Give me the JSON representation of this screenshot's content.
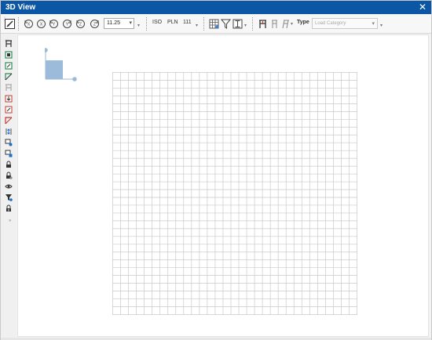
{
  "window": {
    "title": "3D View",
    "close_glyph": "✕"
  },
  "toolbar": {
    "zoom_value": "11.25",
    "view_iso": "ISO",
    "view_pln": "PLN",
    "view_num": "111",
    "type_label": "Type",
    "load_category_placeholder": "Load Category",
    "icons": [
      "pointer-icon",
      "rotate-left-x-icon",
      "rotate-x-icon",
      "rotate-left-y-icon",
      "rotate-y-icon",
      "rotate-left-z-icon",
      "rotate-z-icon",
      "grid-table-icon",
      "filter-icon",
      "display-options-icon",
      "member-load-icon",
      "member-outline-icon",
      "member-italic-icon"
    ]
  },
  "sidebar": {
    "icons": [
      "beam-icon",
      "frame-green-icon",
      "plate-green-icon",
      "brace-green-icon",
      "beam-gray-icon",
      "load-red-icon",
      "frame-red-icon",
      "slash-red-icon",
      "scale-blue-icon",
      "plot-blue-icon",
      "plot-blue-2-icon",
      "lock-icon",
      "lock-gear-icon",
      "eye-icon",
      "filter-blue-icon",
      "lock-arrow-icon"
    ],
    "more": "»"
  },
  "colors": {
    "title_bg": "#0b57a6",
    "cube_fill": "#9cbad9",
    "grid_line": "#c9c9c9"
  }
}
